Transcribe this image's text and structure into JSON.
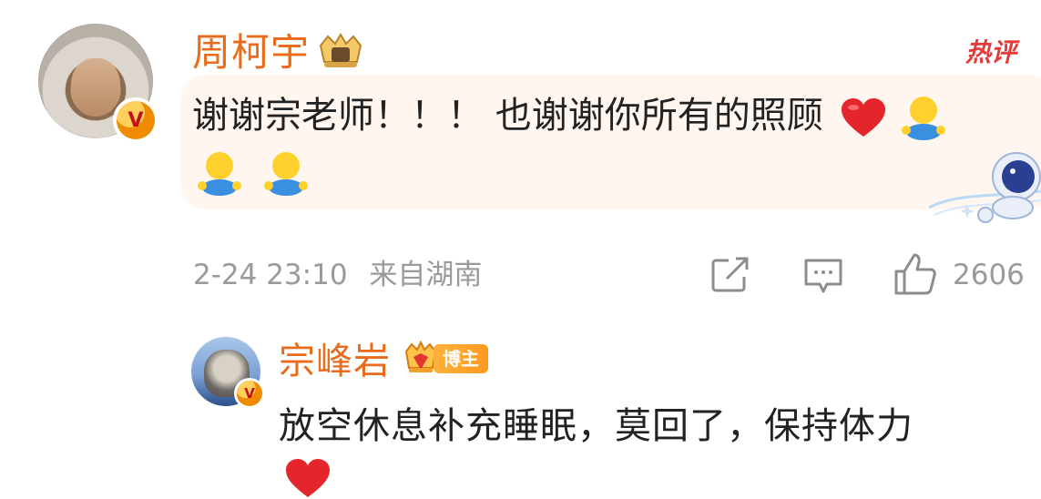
{
  "main_comment": {
    "username": "周柯宇",
    "text": "谢谢宗老师！！！ 也谢谢你所有的照顾",
    "hot_label": "热评",
    "date": "2-24 23:10",
    "location": "来自湖南",
    "like_count": "2606",
    "emojis": [
      "red-heart",
      "blue-shirt-smiley",
      "blue-shirt-smiley",
      "blue-shirt-smiley"
    ]
  },
  "reply": {
    "username": "宗峰岩",
    "badge": "博主",
    "text": "放空休息补充睡眠，莫回了，保持体力",
    "emoji": "red-heart"
  },
  "colors": {
    "username": "#e86c1c",
    "hot": "#e33a3a",
    "meta": "#9a9a9a",
    "bubble": "#fff6ef"
  }
}
